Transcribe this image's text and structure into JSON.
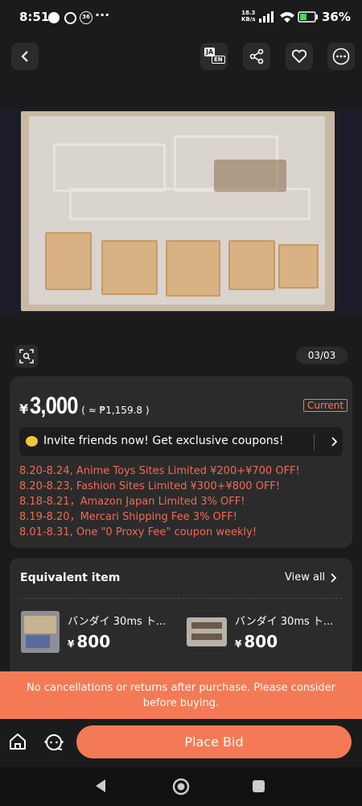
{
  "status_bar": {
    "time": "8:51",
    "notif_count": "36",
    "more_dots": "···",
    "net_speed_value": "18.3",
    "net_speed_unit": "KB/s",
    "battery": "36%"
  },
  "top_nav": {
    "translate_label_top": "JA",
    "translate_label_bottom": "EN",
    "icons": [
      "back-arrow-icon",
      "translate-icon",
      "share-icon",
      "heart-icon",
      "more-icon"
    ]
  },
  "gallery": {
    "counter": "03/03"
  },
  "price_card": {
    "currency": "¥",
    "price": "3,000",
    "converted": "( ≈ ₱1,159.8 )",
    "badge": "Current",
    "invite_text": "Invite friends now! Get exclusive coupons!",
    "promos": [
      "8.20-8.24, Anime Toys Sites Limited ¥200+¥700 OFF!",
      "8.20-8.23, Fashion Sites Limited ¥300+¥800 OFF!",
      "8.18-8.21，Amazon Japan Limited 3% OFF!",
      "8.19-8.20，Mercari Shipping Fee 3% OFF!",
      "8.01-8.31, One \"0 Proxy Fee\" coupon weekly!"
    ]
  },
  "equivalent": {
    "title": "Equivalent item",
    "view_all": "View all",
    "items": [
      {
        "name": "バンダイ 30ms ト...",
        "currency": "¥",
        "price": "800"
      },
      {
        "name": "バンダイ 30ms ト...",
        "currency": "¥",
        "price": "800"
      }
    ]
  },
  "notice": {
    "text": "No cancellations or returns after purchase. Please consider before buying."
  },
  "footer": {
    "place_bid": "Place Bid"
  },
  "colors": {
    "accent": "#f47a55",
    "promo_red": "#f06a55",
    "card_bg": "#2b2b2b",
    "page_bg": "#1b1b1b"
  }
}
